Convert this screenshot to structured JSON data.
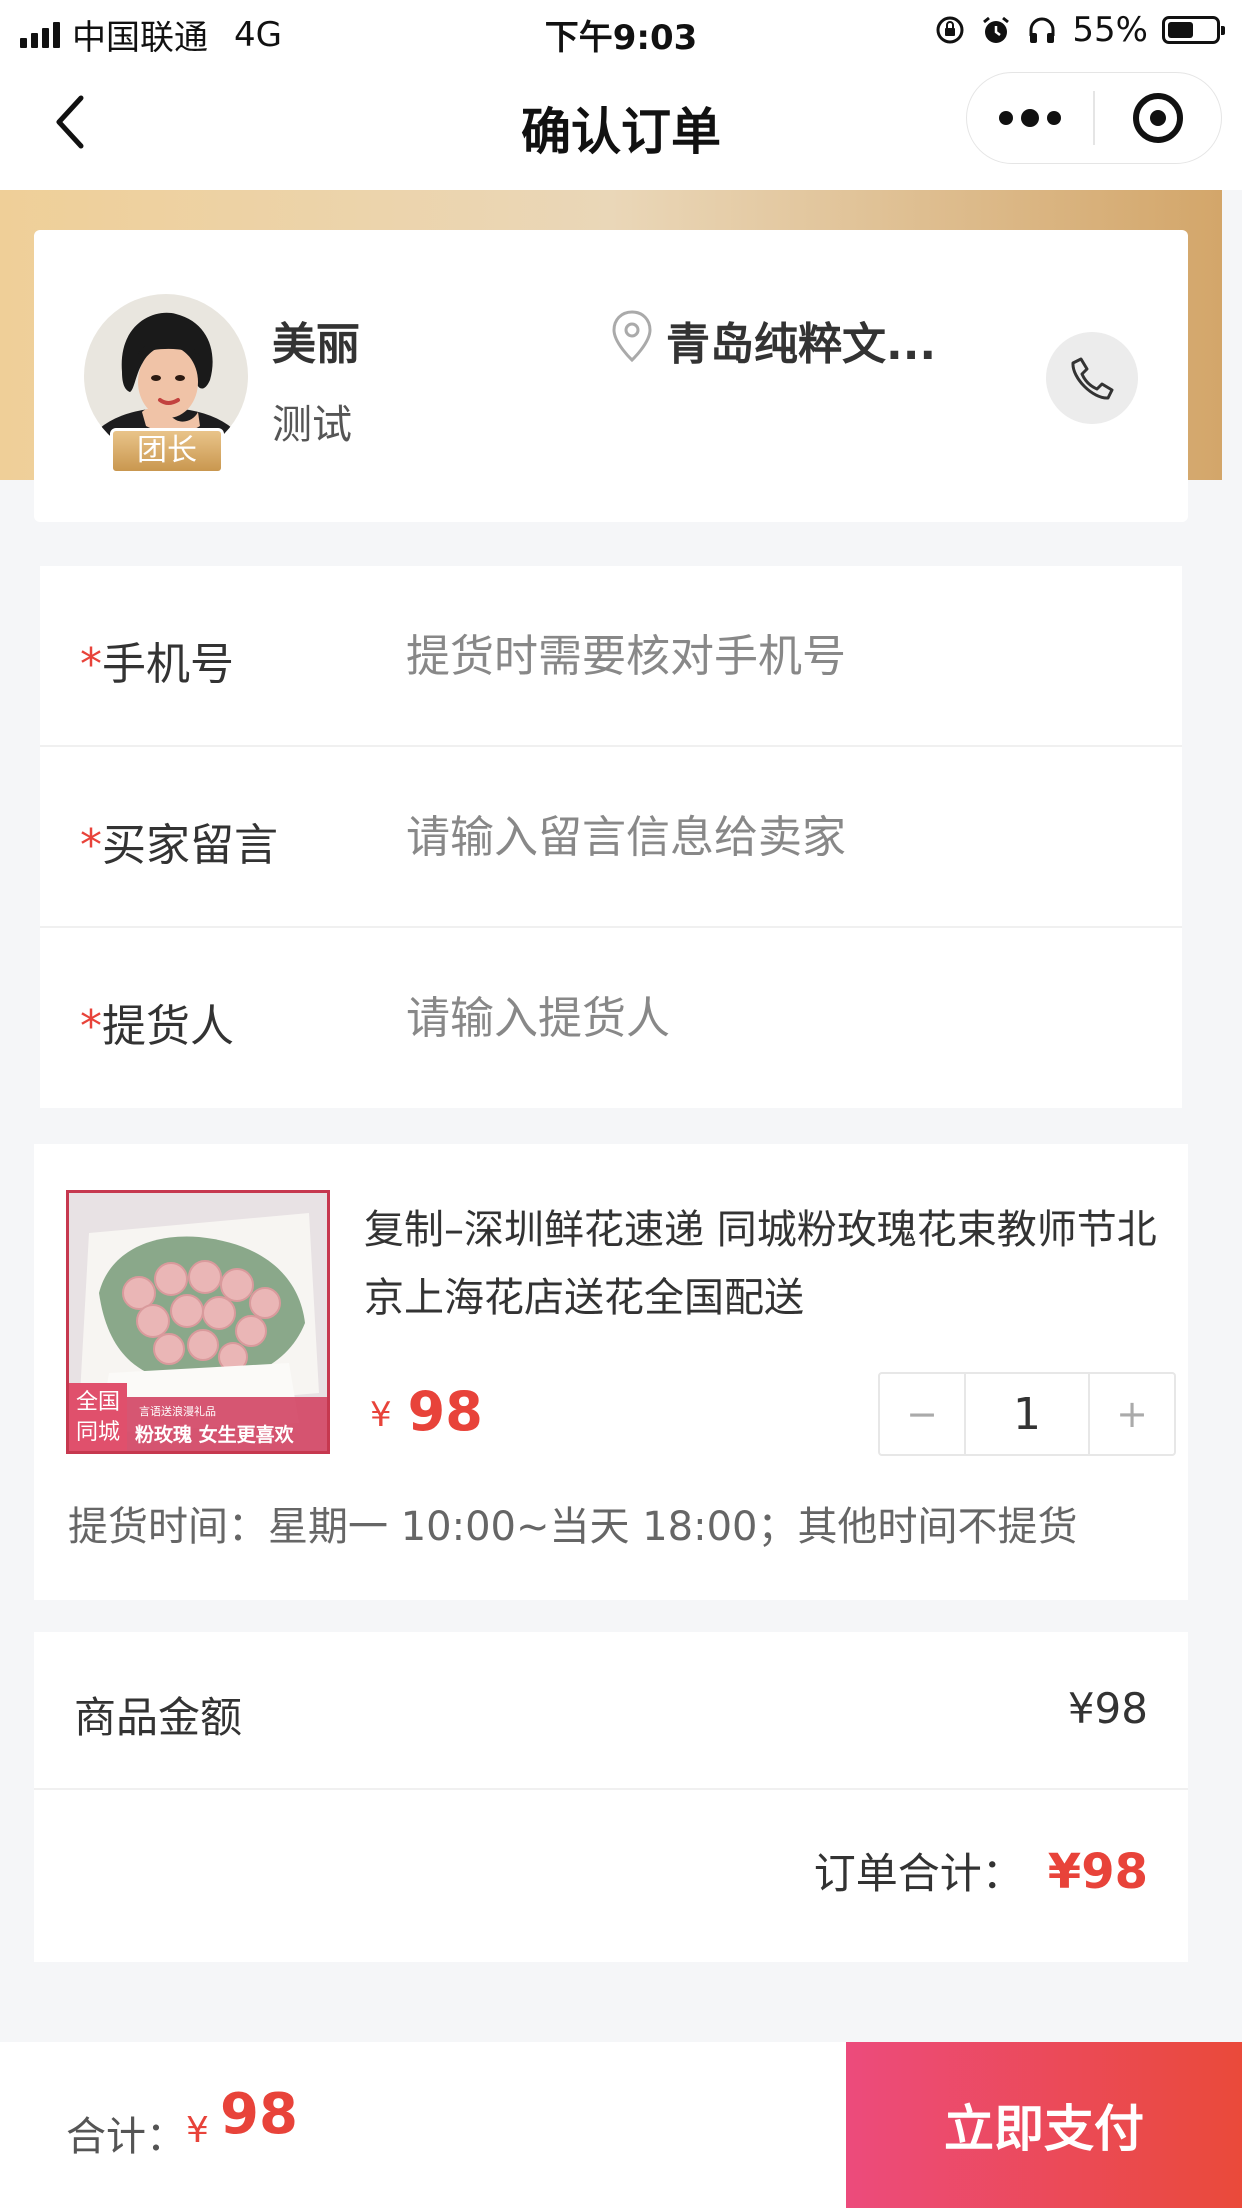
{
  "status_bar": {
    "carrier": "中国联通",
    "network": "4G",
    "time": "下午9:03",
    "battery": "55%",
    "battery_level": 0.55,
    "icons": [
      "signal-icon",
      "rotation-lock-icon",
      "alarm-icon",
      "headphones-icon",
      "battery-icon"
    ]
  },
  "nav": {
    "title": "确认订单",
    "back_icon": "chevron-left-icon",
    "more_icon": "more-dots-icon",
    "close_icon": "target-circle-icon"
  },
  "leader": {
    "name": "美丽",
    "subtitle": "测试",
    "badge": "团长",
    "location": "青岛纯粹文...",
    "location_icon": "location-pin-icon",
    "phone_icon": "phone-icon"
  },
  "form": {
    "phone": {
      "label": "手机号",
      "required": "*",
      "placeholder": "提货时需要核对手机号",
      "value": ""
    },
    "message": {
      "label": "买家留言",
      "required": "*",
      "placeholder": "请输入留言信息给卖家",
      "value": ""
    },
    "pickup_person": {
      "label": "提货人",
      "required": "*",
      "placeholder": "请输入提货人",
      "value": ""
    }
  },
  "product": {
    "title": "复制–深圳鲜花速递 同城粉玫瑰花束教师节北京上海花店送花全国配送",
    "currency": "¥",
    "price": "98",
    "quantity": "1",
    "minus": "−",
    "plus": "+",
    "pickup_time": "提货时间：星期一 10:00~当天 18:00；其他时间不提货",
    "image_text": {
      "corner": "全国同城",
      "tag": "粉玫瑰 女生更喜欢",
      "small": "言语送浪漫礼品",
      "mark": "送"
    }
  },
  "amounts": {
    "goods_label": "商品金额",
    "goods_value": "¥98",
    "total_label": "订单合计：",
    "total_value": "¥98"
  },
  "bottom": {
    "total_label": "合计：",
    "currency": "¥",
    "total": "98",
    "pay_label": "立即支付"
  },
  "colors": {
    "accent_red": "#e8433a",
    "gold": "#d3a66a",
    "pay_gradient_start": "#ec4b7c",
    "pay_gradient_end": "#ea4a3a"
  }
}
